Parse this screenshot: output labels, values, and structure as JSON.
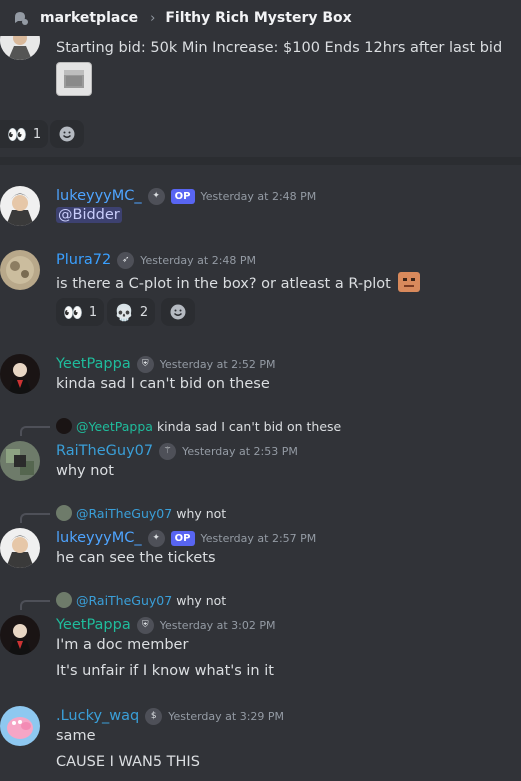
{
  "header": {
    "channel": "marketplace",
    "separator": "›",
    "thread": "Filthy Rich Mystery Box"
  },
  "colors": {
    "background": "#313338",
    "op_badge": "#5865f2",
    "lukeyyy_name": "#4ea4ff",
    "plura_name": "#3aa0ff",
    "yeetpappa_name": "#1fbc9c",
    "rai_name": "#3a9fd8",
    "lucky_name": "#3a9fd8"
  },
  "top_message": {
    "text": "Starting bid: 50k Min Increase: $100 Ends 12hrs after last bid",
    "reactions": [
      {
        "emoji": "👀",
        "count": "1"
      }
    ]
  },
  "messages": [
    {
      "author": "lukeyyyMC_",
      "badge_icon": "shield-icon",
      "op": "OP",
      "timestamp": "Yesterday at 2:48 PM",
      "mention": "@Bidder"
    },
    {
      "author": "Plura72",
      "badge_icon": "rocket-icon",
      "timestamp": "Yesterday at 2:48 PM",
      "text": "is there a C-plot in the box? or atleast a R-plot",
      "reactions": [
        {
          "emoji": "👀",
          "count": "1"
        },
        {
          "emoji": "💀",
          "count": "2"
        }
      ]
    },
    {
      "author": "YeetPappa",
      "badge_icon": "shield-icon",
      "timestamp": "Yesterday at 2:52 PM",
      "text": "kinda sad I can't bid on these"
    },
    {
      "reply_to_name": "@YeetPappa",
      "reply_to_text": "kinda sad I can't bid on these",
      "author": "RaiTheGuy07",
      "badge_icon": "staff-icon",
      "timestamp": "Yesterday at 2:53 PM",
      "text": "why not"
    },
    {
      "reply_to_name": "@RaiTheGuy07",
      "reply_to_text": "why not",
      "author": "lukeyyyMC_",
      "badge_icon": "shield-icon",
      "op": "OP",
      "timestamp": "Yesterday at 2:57 PM",
      "text": "he can see the tickets"
    },
    {
      "reply_to_name": "@RaiTheGuy07",
      "reply_to_text": "why not",
      "author": "YeetPappa",
      "badge_icon": "shield-icon",
      "timestamp": "Yesterday at 3:02 PM",
      "text": "I'm a doc member",
      "text2": "It's unfair if I know what's in it"
    },
    {
      "author": ".Lucky_waq",
      "badge_icon": "dollar-icon",
      "timestamp": "Yesterday at 3:29 PM",
      "text": "same",
      "text2": "CAUSE I WAN5 THIS"
    }
  ]
}
